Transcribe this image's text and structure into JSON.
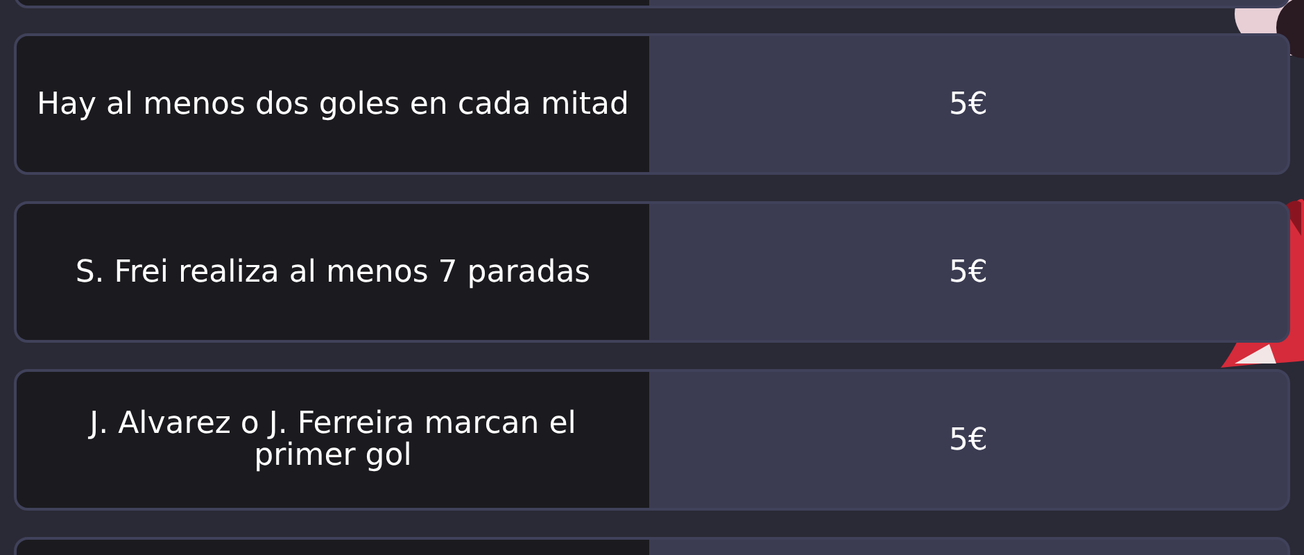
{
  "bets": [
    {
      "description": "Hay al menos dos goles en cada mitad",
      "price": "5€"
    },
    {
      "description": "S. Frei realiza al menos 7 paradas",
      "price": "5€"
    },
    {
      "description": "J. Alvarez o J. Ferreira marcan el primer gol",
      "price": "5€"
    }
  ]
}
